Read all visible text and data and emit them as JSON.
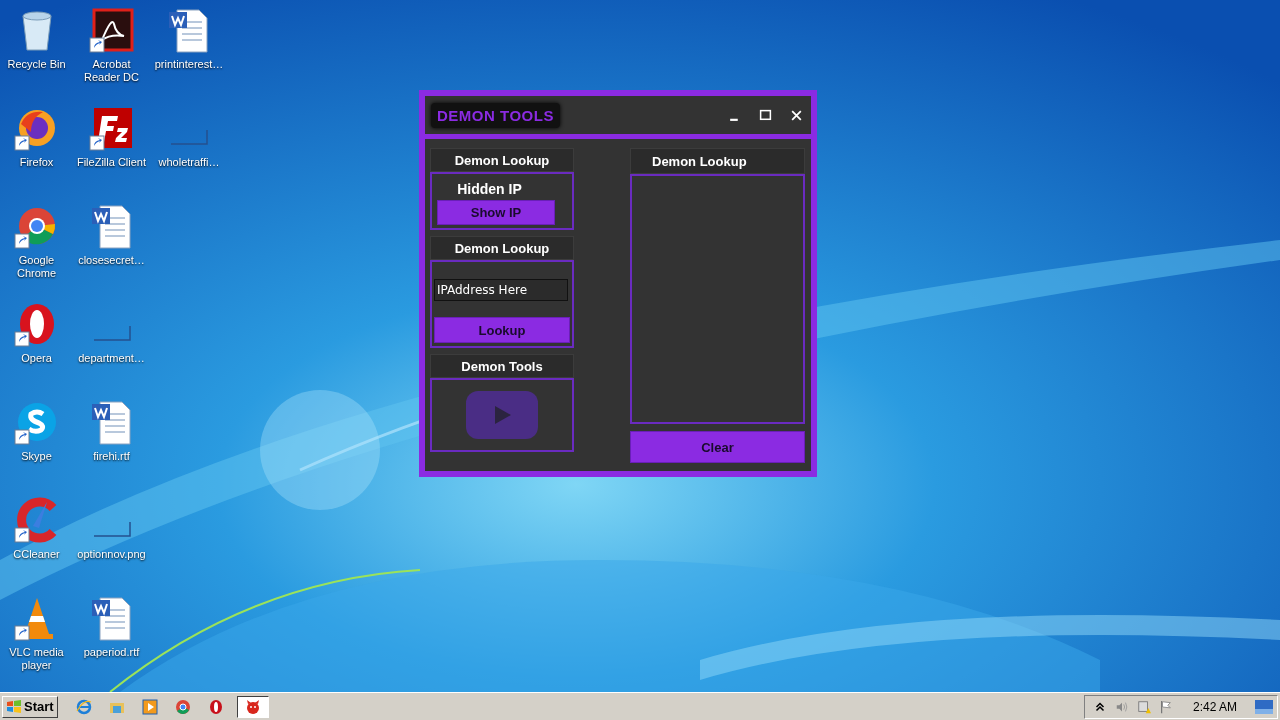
{
  "desktop": {
    "icons": [
      {
        "label": "Recycle Bin",
        "kind": "recycle"
      },
      {
        "label": "Firefox",
        "kind": "firefox"
      },
      {
        "label": "Google Chrome",
        "kind": "chrome"
      },
      {
        "label": "Opera",
        "kind": "opera"
      },
      {
        "label": "Skype",
        "kind": "skype"
      },
      {
        "label": "CCleaner",
        "kind": "ccleaner"
      },
      {
        "label": "VLC media player",
        "kind": "vlc"
      },
      {
        "label": "Acrobat Reader DC",
        "kind": "acrobat"
      },
      {
        "label": "FileZilla Client",
        "kind": "filezilla"
      },
      {
        "label": "closesecret…",
        "kind": "word"
      },
      {
        "label": "department…",
        "kind": "blank"
      },
      {
        "label": "firehi.rtf",
        "kind": "word"
      },
      {
        "label": "optionnov.png",
        "kind": "blank"
      },
      {
        "label": "paperiod.rtf",
        "kind": "word"
      },
      {
        "label": "printinterest…",
        "kind": "word"
      },
      {
        "label": "wholetraffi…",
        "kind": "blank"
      }
    ]
  },
  "window": {
    "title": "DEMON TOOLS"
  },
  "left_panels": [
    {
      "header": "Demon Lookup",
      "kind": "show_ip",
      "label": "Hidden IP",
      "button": "Show IP"
    },
    {
      "header": "Demon Lookup",
      "kind": "lookup",
      "placeholder": "IPAddress Here",
      "button": "Lookup"
    },
    {
      "header": "Demon Tools",
      "kind": "video"
    }
  ],
  "output": {
    "header": "Demon Lookup",
    "button": "Clear"
  },
  "taskbar": {
    "start": "Start",
    "apps": [
      {
        "kind": "ie",
        "selected": false
      },
      {
        "kind": "folder",
        "selected": false
      },
      {
        "kind": "media",
        "selected": false
      },
      {
        "kind": "chrome",
        "selected": false
      },
      {
        "kind": "opera",
        "selected": false
      },
      {
        "kind": "demon",
        "selected": true
      }
    ],
    "clock": "2:42 AM"
  }
}
